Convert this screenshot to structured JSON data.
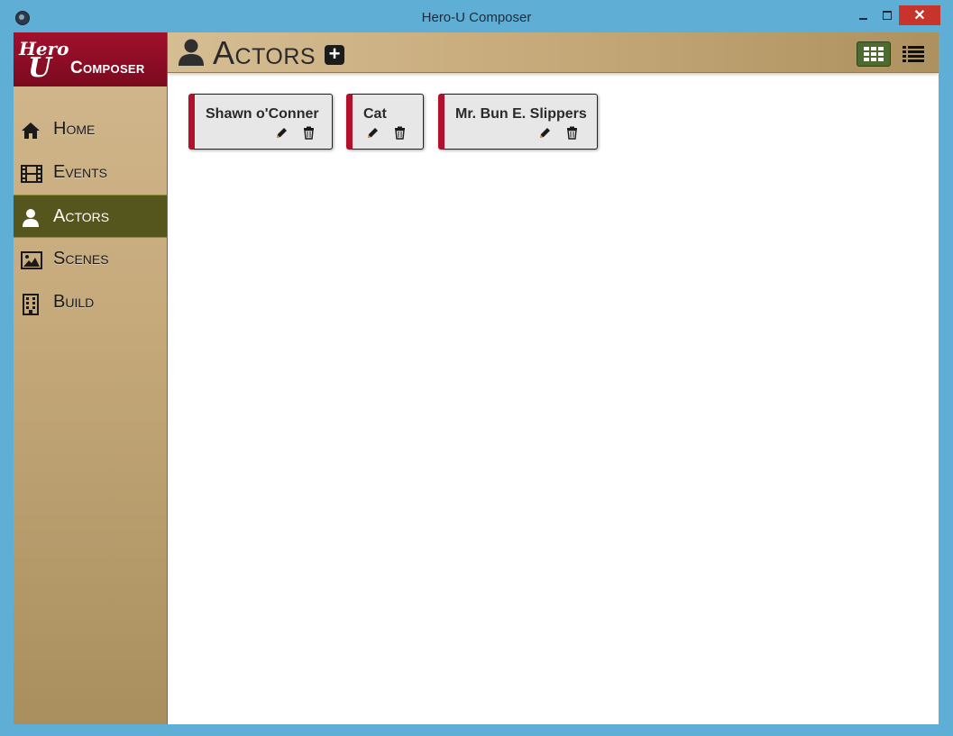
{
  "window": {
    "title": "Hero-U Composer",
    "minimize_label": "",
    "maximize_label": "",
    "close_label": "✕"
  },
  "logo": {
    "hero_text_top": "Hero",
    "hero_text_u": "U",
    "composer": "Composer"
  },
  "sidebar": {
    "items": [
      {
        "label": "Home",
        "icon": "home-icon",
        "active": false
      },
      {
        "label": "Events",
        "icon": "film-icon",
        "active": false
      },
      {
        "label": "Actors",
        "icon": "user-icon",
        "active": true
      },
      {
        "label": "Scenes",
        "icon": "image-icon",
        "active": false
      },
      {
        "label": "Build",
        "icon": "building-icon",
        "active": false
      }
    ]
  },
  "header": {
    "title": "Actors",
    "add_label": "+"
  },
  "actors": [
    {
      "name": "Shawn o'Conner"
    },
    {
      "name": "Cat"
    },
    {
      "name": "Mr. Bun E. Slippers"
    }
  ],
  "colors": {
    "accent": "#b0112d",
    "active_nav": "#55561e",
    "grid_view_active": "#4d6b2f"
  }
}
